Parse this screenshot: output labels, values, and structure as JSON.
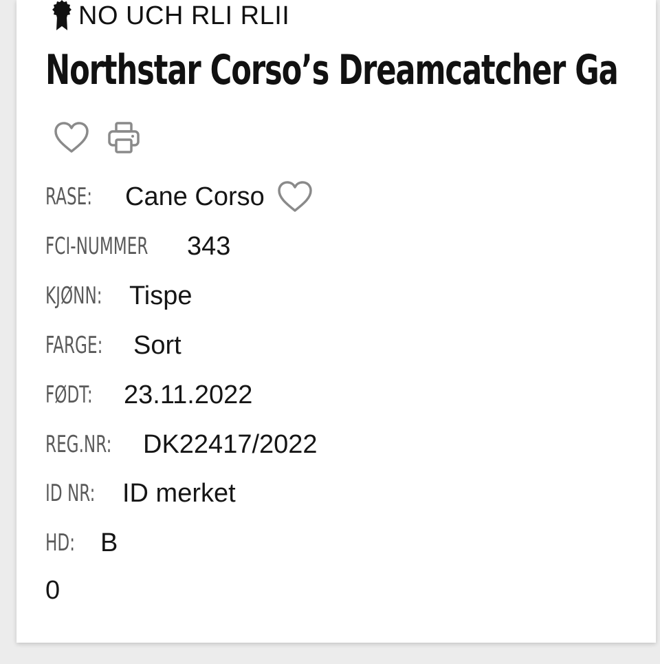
{
  "header": {
    "titles": "NO UCH RLI RLII",
    "award_icon": "award-rosette-icon",
    "dog_name": "Northstar Corso’s Dreamcatcher Ga"
  },
  "actions": {
    "favorite_icon": "heart-outline-icon",
    "print_icon": "printer-icon"
  },
  "details": [
    {
      "label": "RASE:",
      "value": "Cane Corso"
    },
    {
      "label": "FCI-NUMMER",
      "value": "343"
    },
    {
      "label": "KJØNN:",
      "value": "Tispe"
    },
    {
      "label": "FARGE:",
      "value": "Sort"
    },
    {
      "label": "FØDT:",
      "value": "23.11.2022"
    },
    {
      "label": "REG.NR:",
      "value": "DK22417/2022"
    },
    {
      "label": "ID NR:",
      "value": "ID merket"
    },
    {
      "label": "HD:",
      "value": "B"
    }
  ],
  "trailing_value": "0",
  "colors": {
    "label": "#5a5a5a",
    "value": "#151515",
    "icon_stroke": "#8a8a8a",
    "background": "#ececec",
    "card": "#ffffff"
  }
}
